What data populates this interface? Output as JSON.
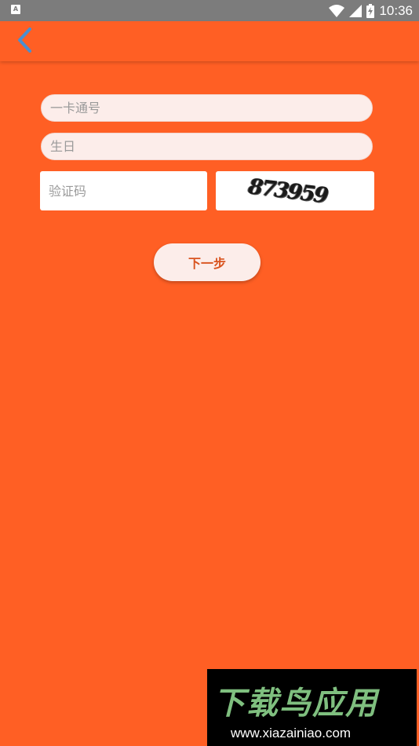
{
  "status_bar": {
    "notification_icon_label": "A",
    "time": "10:36"
  },
  "form": {
    "card_number": {
      "placeholder": "一卡通号",
      "value": ""
    },
    "birthday": {
      "placeholder": "生日",
      "value": ""
    },
    "captcha": {
      "placeholder": "验证码",
      "value": ""
    },
    "captcha_code": "873959",
    "next_label": "下一步"
  },
  "watermark": {
    "title": "下载鸟应用",
    "url": "www.xiazainiao.com"
  },
  "colors": {
    "background": "#FF5F24",
    "status_bar": "#7C7C7C",
    "field_fill": "#FCEDEA",
    "back_arrow": "#4A8FD0",
    "button_text": "#D9541F",
    "watermark_green": "#7FBF7F"
  },
  "icons": {
    "back": "chevron-left-icon",
    "wifi": "wifi-icon",
    "signal": "cell-signal-icon",
    "battery": "battery-charging-icon",
    "notification": "notification-a-icon"
  }
}
